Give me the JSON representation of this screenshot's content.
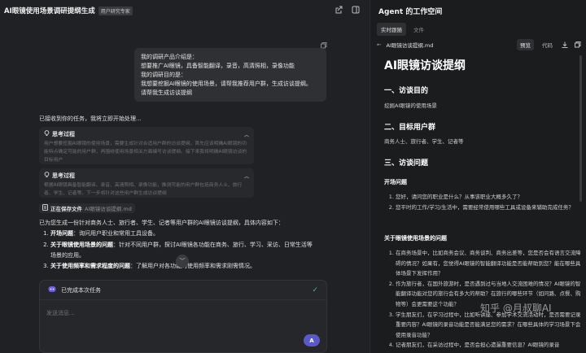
{
  "header": {
    "title": "AI眼镜使用场景调研提纲生成",
    "tag": "用户研究专家"
  },
  "user_message": {
    "lines": [
      "我的调研产品介绍是：",
      "想要推广AI眼镜，具备智能翻译，录音，高清照相，录像功能",
      "我的调研目的是：",
      "我想要挖掘AI眼镜的使用场景，请帮我推荐用户群，生成访谈提纲。",
      "请帮我生成访谈提纲"
    ]
  },
  "ack_text": "已接收到你的任务，我将立即开始处理...",
  "thoughts": [
    {
      "title": "思考过程",
      "body": "用户想要挖掘AI眼镜的使用场景，需要生成针对合适用户群的访谈提纲。首先应该明确AI眼镜的功能特点确定可能的用户群，再围绕使用场景相关方面编写访谈提纲。接下来我将明确AI眼镜访谈的目标用户"
    },
    {
      "title": "思考过程",
      "body": "根据AI眼镜具备智能翻译、录音、高清照相、录像功能，推测可能的用户群包括商务人士、旅行者、学生、记者等。下一步将针对这些用户群生成访谈提纲"
    }
  ],
  "saving": {
    "label": "正在保存文件",
    "filename": "AI眼镜访谈提纲.md"
  },
  "answer": {
    "intro": "已为您生成一份针对商务人士、旅行者、学生、记者等用户群的AI眼镜访谈提纲，具体内容如下：",
    "items": [
      {
        "bold": "开场问题",
        "text": "：询问用户职业和常用工具设备。"
      },
      {
        "bold": "关于眼镜使用场景的问题",
        "text": "：针对不同用户群，探讨AI眼镜各功能在商务、旅行、学习、采访、日常生活等场景的应用。"
      },
      {
        "bold": "关于使用频率和需求程度的问题",
        "text": "：了解用户对各功能的使用频率和需求刚需情况。"
      }
    ]
  },
  "composer": {
    "task_status": "已完成本次任务",
    "placeholder": "发送消息...",
    "send_label": "A"
  },
  "workspace": {
    "title": "Agent 的工作空间",
    "tabs": [
      "实时跟随",
      "文件"
    ],
    "filename": "AI眼镜访谈提纲.md",
    "modes": [
      "预览",
      "代码"
    ]
  },
  "doc": {
    "h1": "AI眼镜访谈提纲",
    "s1_title": "一、访谈目的",
    "s1_text": "挖掘AI眼镜的使用场景",
    "s2_title": "二、目标用户群",
    "s2_text": "商务人士、旅行者、学生、记者等",
    "s3_title": "三、访谈问题",
    "sub1_title": "开场问题",
    "sub1_items": [
      "您好，请问您的职业是什么？从事该职业大概多久了？",
      "您平时的工作/学习/生活中，需要经常使用哪些工具或设备来辅助完成任务？"
    ],
    "sub2_title": "关于眼镜使用场景的问题",
    "sub2_items": [
      "在商务场景中，比如商务会议、商务谈判、商务出差等，您是否会有语言交流障碍的情况？如果有，您觉得AI眼镜的智能翻译功能是否能帮助到您？能在哪些具体场景下发挥作用？",
      "作为旅行者，在国外旅游时，是否遇到过与当地人交流困难的情况？AI眼镜的智能翻译功能对您的旅行会有多大的帮助？在旅行的哪些环节（如问路、点餐、购物等）会更需要这个功能？",
      "学生朋友们，在学习过程中，比如听讲座、参加学术交流活动时，是否需要记录重要内容？AI眼镜的录音功能是否能满足您的需求？在哪些具体的学习场景下会使用录音功能？",
      "记者朋友们，在采访过程中，是否会担心遗漏重要信息？AI眼镜的录音"
    ]
  },
  "watermark": "知乎 @月叔聊AI"
}
